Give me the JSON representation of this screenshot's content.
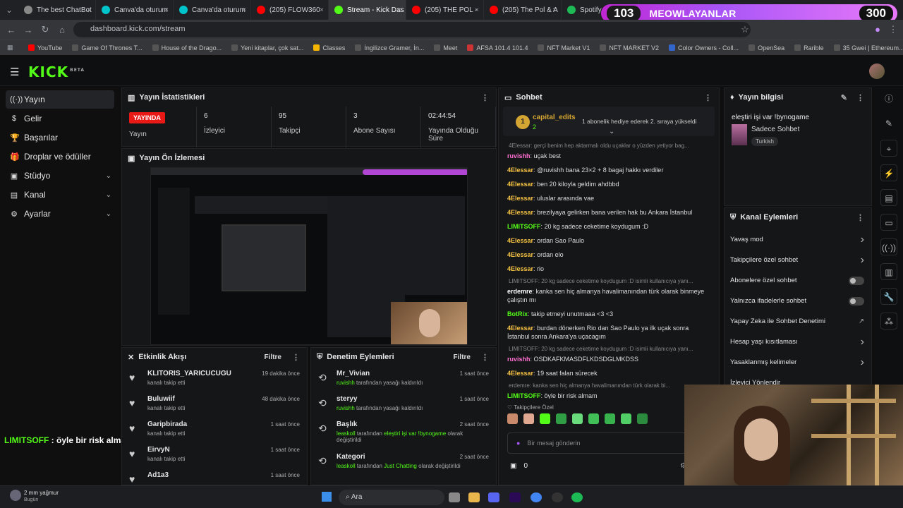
{
  "browser": {
    "tabs": [
      {
        "label": "The best ChatBot",
        "color": "#888"
      },
      {
        "label": "Canva'da oturum",
        "color": "#00c4cc"
      },
      {
        "label": "Canva'da oturum",
        "color": "#00c4cc"
      },
      {
        "label": "(205) FLOW360",
        "color": "#ff0000"
      },
      {
        "label": "Stream - Kick Das",
        "color": "#53fc18"
      },
      {
        "label": "(205) THE POL -",
        "color": "#ff0000"
      },
      {
        "label": "(205) The Pol & A",
        "color": "#ff0000"
      },
      {
        "label": "Spotify",
        "color": "#1db954"
      }
    ],
    "url": "dashboard.kick.com/stream",
    "bookmarks": [
      {
        "label": "YouTube",
        "color": "#ff0000"
      },
      {
        "label": "Game Of Thrones T...",
        "color": "#555"
      },
      {
        "label": "House of the Drago...",
        "color": "#555"
      },
      {
        "label": "Yeni kitaplar, çok sat...",
        "color": "#555"
      },
      {
        "label": "Classes",
        "color": "#f4b400"
      },
      {
        "label": "İngilizce Gramer, İn...",
        "color": "#555"
      },
      {
        "label": "Meet",
        "color": "#555"
      },
      {
        "label": "AFSA 101.4 101.4",
        "color": "#c33"
      },
      {
        "label": "NFT Market V1",
        "color": "#555"
      },
      {
        "label": "NFT MARKET V2",
        "color": "#555"
      },
      {
        "label": "Color Owners - Coll...",
        "color": "#36c"
      },
      {
        "label": "OpenSea",
        "color": "#555"
      },
      {
        "label": "Rarible",
        "color": "#555"
      },
      {
        "label": "35 Gwei | Ethereum...",
        "color": "#555"
      }
    ]
  },
  "promo": {
    "left": "103",
    "text": "MEOWLAYANLAR",
    "right": "300"
  },
  "brand": {
    "logo": "KICK",
    "beta": "BETA"
  },
  "sidebar": [
    {
      "label": "Yayın",
      "icon": "((·))",
      "chev": ""
    },
    {
      "label": "Gelir",
      "icon": "$",
      "chev": ""
    },
    {
      "label": "Başarılar",
      "icon": "🏆",
      "chev": ""
    },
    {
      "label": "Droplar ve ödüller",
      "icon": "🎁",
      "chev": ""
    },
    {
      "label": "Stüdyo",
      "icon": "▣",
      "chev": "⌄"
    },
    {
      "label": "Kanal",
      "icon": "▤",
      "chev": "⌄"
    },
    {
      "label": "Ayarlar",
      "icon": "⚙",
      "chev": "⌄"
    }
  ],
  "stats_panel": {
    "title": "Yayın İstatistikleri",
    "live_badge": "YAYINDA",
    "items": [
      {
        "v": "",
        "l": "Yayın"
      },
      {
        "v": "6",
        "l": "İzleyici"
      },
      {
        "v": "95",
        "l": "Takipçi"
      },
      {
        "v": "3",
        "l": "Abone Sayısı"
      },
      {
        "v": "02:44:54",
        "l": "Yayında Olduğu Süre"
      }
    ]
  },
  "preview_panel": {
    "title": "Yayın Ön İzlemesi"
  },
  "activity": {
    "title": "Etkinlik Akışı",
    "filter": "Filtre",
    "rows": [
      {
        "name": "KLITORIS_YARICUCUGU",
        "sub": "kanalı takip etti",
        "time": "19 dakika önce"
      },
      {
        "name": "Buluwiif",
        "sub": "kanalı takip etti",
        "time": "48 dakika önce"
      },
      {
        "name": "Garipbirada",
        "sub": "kanalı takip etti",
        "time": "1 saat önce"
      },
      {
        "name": "EirvyN",
        "sub": "kanalı takip etti",
        "time": "1 saat önce"
      },
      {
        "name": "Ad1a3",
        "sub": "",
        "time": "1 saat önce"
      }
    ]
  },
  "moderation": {
    "title": "Denetim Eylemleri",
    "filter": "Filtre",
    "rows": [
      {
        "name": "Mr_Vivian",
        "pre": "ruvishh",
        "mid": " tarafından yasağı kaldırıldı",
        "hl": "",
        "post": "",
        "time": "1 saat önce"
      },
      {
        "name": "steryy",
        "pre": "ruvishh",
        "mid": " tarafından yasağı kaldırıldı",
        "hl": "",
        "post": "",
        "time": "1 saat önce"
      },
      {
        "name": "Başlık",
        "pre": "leaskoll",
        "mid": " tarafından ",
        "hl": "eleştiri işi var !bynogame",
        "post": " olarak değiştirildi",
        "time": "2 saat önce"
      },
      {
        "name": "Kategori",
        "pre": "leaskoll",
        "mid": " tarafından ",
        "hl": "Just Chatting",
        "post": " olarak değiştirildi",
        "time": "2 saat önce"
      }
    ]
  },
  "chat": {
    "title": "Sohbet",
    "pinned_user": "capital_edits",
    "pinned_badge": "2",
    "pinned_text": "1 abonelik hediye ederek 2. sıraya yükseldi",
    "messages": [
      {
        "type": "reply",
        "text": "4Elessar: gerçi benim hep aktarmalı oldu uçaklar o yüzden yetiyor bag..."
      },
      {
        "type": "msg",
        "user": "ruvishh",
        "color": "#ff6fd0",
        "text": "uçak best"
      },
      {
        "type": "msg",
        "user": "4Elessar",
        "color": "#f6c343",
        "text": "@ruvishh bana 23×2 + 8 bagaj hakkı verdiler"
      },
      {
        "type": "msg",
        "user": "4Elessar",
        "color": "#f6c343",
        "text": "ben 20 kiloyla geldim ahdbbd"
      },
      {
        "type": "msg",
        "user": "4Elessar",
        "color": "#f6c343",
        "text": "uluslar arasında vae"
      },
      {
        "type": "msg",
        "user": "4Elessar",
        "color": "#f6c343",
        "text": "brezilyaya gelirken bana verilen hak bu Ankara İstanbul"
      },
      {
        "type": "msg",
        "user": "LIMITSOFF",
        "color": "#53fc18",
        "text": "20 kg sadece ceketime koydugum :D"
      },
      {
        "type": "msg",
        "user": "4Elessar",
        "color": "#f6c343",
        "text": "ordan Sao Paulo"
      },
      {
        "type": "msg",
        "user": "4Elessar",
        "color": "#f6c343",
        "text": "ordan elo"
      },
      {
        "type": "msg",
        "user": "4Elessar",
        "color": "#f6c343",
        "text": "rio"
      },
      {
        "type": "reply",
        "text": "LIMITSOFF: 20 kg sadece ceketime koydugum :D isimli kullanıcıya yanı..."
      },
      {
        "type": "msg",
        "user": "erdemre",
        "color": "#ffffff",
        "text": "kanka sen hiç almanya havalimanından türk olarak binmeye çalıştın mı"
      },
      {
        "type": "msg",
        "user": "BotRix",
        "color": "#53fc18",
        "text": "takip etmeyi unutmaaa <3 <3"
      },
      {
        "type": "msg",
        "user": "4Elessar",
        "color": "#f6c343",
        "text": "burdan dönerken Rio dan Sao Paulo ya ilk uçak sonra İstanbul sonra Ankara'ya uçacagım"
      },
      {
        "type": "reply",
        "text": "LIMITSOFF: 20 kg sadece ceketime koydugum :D isimli kullanıcıya yanı..."
      },
      {
        "type": "msg",
        "user": "ruvishh",
        "color": "#ff6fd0",
        "text": "OSDKAFKMASDFLKDSDGLMKDSS"
      },
      {
        "type": "msg",
        "user": "4Elessar",
        "color": "#f6c343",
        "text": "19 saat falan sürecek"
      },
      {
        "type": "reply",
        "text": "erdemre: kanka sen hiç almanya havalimanından türk olarak bi..."
      },
      {
        "type": "msg",
        "user": "LIMITSOFF",
        "color": "#53fc18",
        "text": "öyle bir risk almam"
      }
    ],
    "followers_only": "Takipçilere Özel",
    "input_placeholder": "Bir mesaj gönderin",
    "count": "0"
  },
  "stream_info": {
    "title": "Yayın bilgisi",
    "stream_title": "eleştiri işi var !bynogame",
    "category": "Sadece Sohbet",
    "tag": "Turkish"
  },
  "channel_actions": {
    "title": "Kanal Eylemleri",
    "rows": [
      {
        "label": "Yavaş mod",
        "control": "chevron"
      },
      {
        "label": "Takipçilere özel sohbet",
        "control": "chevron"
      },
      {
        "label": "Abonelere özel sohbet",
        "control": "toggle"
      },
      {
        "label": "Yalnızca ifadelerle sohbet",
        "control": "toggle"
      },
      {
        "label": "Yapay Zeka ile Sohbet Denetimi",
        "control": "link"
      },
      {
        "label": "Hesap yaşı kısıtlaması",
        "control": "chevron"
      },
      {
        "label": "Yasaklanmış kelimeler",
        "control": "chevron"
      },
      {
        "label": "İzleyici Yönlendir",
        "control": ""
      }
    ]
  },
  "overlay": {
    "user": "LIMITSOFF",
    "text": " : öyle bir risk almam"
  },
  "taskbar": {
    "weather": "2 mm yağmur",
    "weather_sub": "Bugün",
    "search": "Ara"
  }
}
